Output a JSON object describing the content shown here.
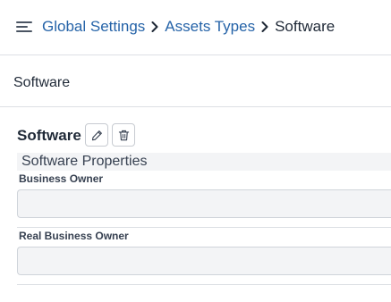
{
  "header": {
    "breadcrumb": {
      "items": [
        "Global Settings",
        "Assets Types"
      ],
      "current": "Software"
    }
  },
  "section": {
    "title": "Software"
  },
  "entity": {
    "title": "Software"
  },
  "properties": {
    "title": "Software Properties",
    "fields": [
      {
        "label": "Business Owner",
        "value": ""
      },
      {
        "label": "Real Business Owner",
        "value": ""
      }
    ]
  },
  "icons": {
    "menu": "hamburger-icon",
    "separator": "chevron-right-icon",
    "edit": "pencil-icon",
    "delete": "trash-icon"
  },
  "colors": {
    "link": "#2563a8",
    "text": "#1f2937",
    "input_bg": "#f3f4f6",
    "border": "#dcdfe4"
  }
}
